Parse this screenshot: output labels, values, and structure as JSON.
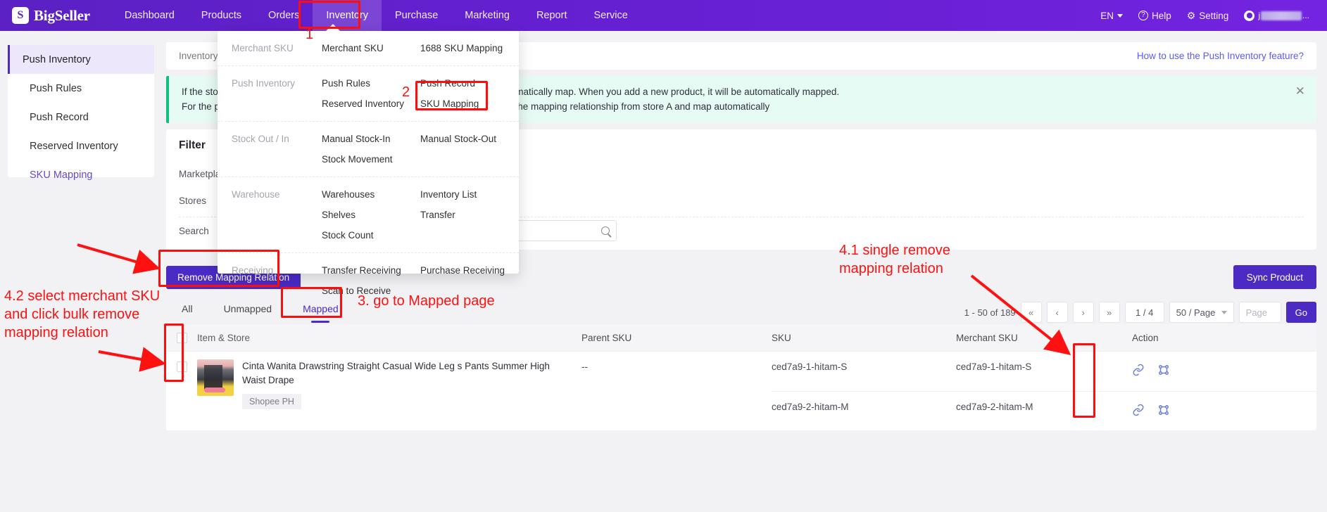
{
  "brand": {
    "name": "BigSeller",
    "logo_icon": "bigseller-logo-icon"
  },
  "topnav": {
    "items": [
      {
        "label": "Dashboard",
        "active": false
      },
      {
        "label": "Products",
        "active": false
      },
      {
        "label": "Orders",
        "active": false
      },
      {
        "label": "Inventory",
        "active": true
      },
      {
        "label": "Purchase",
        "active": false
      },
      {
        "label": "Marketing",
        "active": false
      },
      {
        "label": "Report",
        "active": false
      },
      {
        "label": "Service",
        "active": false
      }
    ],
    "language": "EN",
    "help": "Help",
    "setting": "Setting",
    "username": ""
  },
  "mega_menu": {
    "groups": [
      {
        "category": "Merchant SKU",
        "col1": [
          "Merchant SKU"
        ],
        "col2": [
          "1688 SKU Mapping"
        ]
      },
      {
        "category": "Push Inventory",
        "col1": [
          "Push Rules",
          "Reserved Inventory"
        ],
        "col2": [
          "Push Record",
          "SKU Mapping"
        ]
      },
      {
        "category": "Stock Out / In",
        "col1": [
          "Manual Stock-In",
          "Stock Movement"
        ],
        "col2": [
          "Manual Stock-Out"
        ]
      },
      {
        "category": "Warehouse",
        "col1": [
          "Warehouses",
          "Shelves",
          "Stock Count"
        ],
        "col2": [
          "Inventory List",
          "Transfer"
        ]
      },
      {
        "category": "Receiving",
        "col1": [
          "Transfer Receiving",
          "Scan to Receive"
        ],
        "col2": [
          "Purchase Receiving"
        ]
      }
    ]
  },
  "sidebar": {
    "items": [
      {
        "label": "Push Inventory",
        "type": "parent"
      },
      {
        "label": "Push Rules",
        "type": "child"
      },
      {
        "label": "Push Record",
        "type": "child"
      },
      {
        "label": "Reserved Inventory",
        "type": "child"
      },
      {
        "label": "SKU Mapping",
        "type": "child",
        "selected": true
      }
    ]
  },
  "breadcrumb": {
    "text": "Inventory",
    "help_link": "How to use the Push Inventory feature?"
  },
  "notice": {
    "line1": "If the store product SKU is the same as the merchant SKU, the system will automatically map. When you add a new product, it will be automatically mapped.",
    "line2": "For the products in store B that are the same as those in store A, you can copy the mapping relationship from store A and map automatically",
    "close_icon": "close-icon"
  },
  "filter": {
    "title": "Filter",
    "marketplace_label": "Marketplace",
    "marketplace_value": "",
    "stores_label": "Stores",
    "stores_value": "",
    "search_label": "Search",
    "search_placeholder": "",
    "search_icon": "search-icon"
  },
  "toolbar": {
    "remove_mapping_label": "Remove Mapping Relation",
    "sync_product_label": "Sync Product"
  },
  "tabs": [
    {
      "label": "All",
      "active": false
    },
    {
      "label": "Unmapped",
      "active": false
    },
    {
      "label": "Mapped",
      "active": true
    }
  ],
  "pagination": {
    "range": "1 - 50 of 189",
    "first_icon": "«",
    "prev_icon": "‹",
    "next_icon": "›",
    "last_icon": "»",
    "page_of": "1 / 4",
    "page_size": "50 / Page",
    "page_input_placeholder": "Page",
    "go_label": "Go"
  },
  "table": {
    "columns": [
      "Item & Store",
      "Parent SKU",
      "SKU",
      "Merchant SKU",
      "Action"
    ],
    "rows": [
      {
        "title": "Cinta Wanita Drawstring Straight Casual Wide Leg s Pants Summer High Waist Drape",
        "store": "Shopee PH",
        "parent_sku": "--",
        "sku": "ced7a9-1-hitam-S",
        "merchant_sku": "ced7a9-1-hitam-S",
        "actions": [
          "link-icon",
          "unlink-icon"
        ]
      },
      {
        "title": "",
        "store": "",
        "parent_sku": "",
        "sku": "ced7a9-2-hitam-M",
        "merchant_sku": "ced7a9-2-hitam-M",
        "actions": [
          "link-icon",
          "unlink-icon"
        ]
      }
    ]
  },
  "annotations": {
    "step1": "1",
    "step2": "2",
    "step3": "3. go to Mapped page",
    "step41": "4.1 single remove\nmapping relation",
    "step42": "4.2 select merchant SKU\nand click bulk remove\nmapping relation"
  },
  "colors": {
    "brand_purple": "#6320cf",
    "primary_button": "#4b2bc4",
    "annotation_red": "#ff1111",
    "notice_green": "#0ec07e",
    "link_blue": "#5a5aff"
  }
}
